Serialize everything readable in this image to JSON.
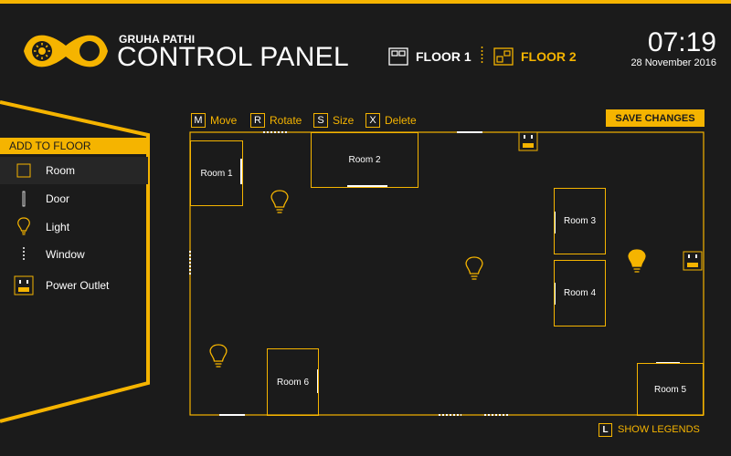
{
  "brand": {
    "subtitle": "GRUHA PATHI",
    "title": "CONTROL PANEL",
    "logo_icon": "sun-moon-logo-icon"
  },
  "floors": [
    {
      "label": "FLOOR 1",
      "icon": "floorplan-icon",
      "selected": false
    },
    {
      "label": "FLOOR 2",
      "icon": "floorplan-icon",
      "selected": true
    }
  ],
  "clock": {
    "time": "07:19",
    "date": "28 November 2016"
  },
  "sidebar": {
    "header": "ADD TO FLOOR",
    "items": [
      {
        "label": "Room",
        "icon": "room-square-icon"
      },
      {
        "label": "Door",
        "icon": "door-icon"
      },
      {
        "label": "Light",
        "icon": "lightbulb-icon"
      },
      {
        "label": "Window",
        "icon": "window-icon"
      },
      {
        "label": "Power Outlet",
        "icon": "power-outlet-icon"
      }
    ]
  },
  "toolbar": {
    "tools": [
      {
        "key": "M",
        "label": "Move"
      },
      {
        "key": "R",
        "label": "Rotate"
      },
      {
        "key": "S",
        "label": "Size"
      },
      {
        "key": "X",
        "label": "Delete"
      }
    ],
    "save_label": "SAVE CHANGES"
  },
  "floorplan": {
    "rooms": [
      "Room 1",
      "Room 2",
      "Room 3",
      "Room 4",
      "Room 5",
      "Room 6"
    ],
    "lights": [
      {
        "name": "light-1",
        "on": false
      },
      {
        "name": "light-2",
        "on": false
      },
      {
        "name": "light-3",
        "on": true
      },
      {
        "name": "light-4",
        "on": false
      }
    ]
  },
  "legend": {
    "key": "L",
    "label": "SHOW LEGENDS"
  },
  "colors": {
    "accent": "#f5b400",
    "background": "#1b1b1b",
    "text": "#ffffff"
  }
}
